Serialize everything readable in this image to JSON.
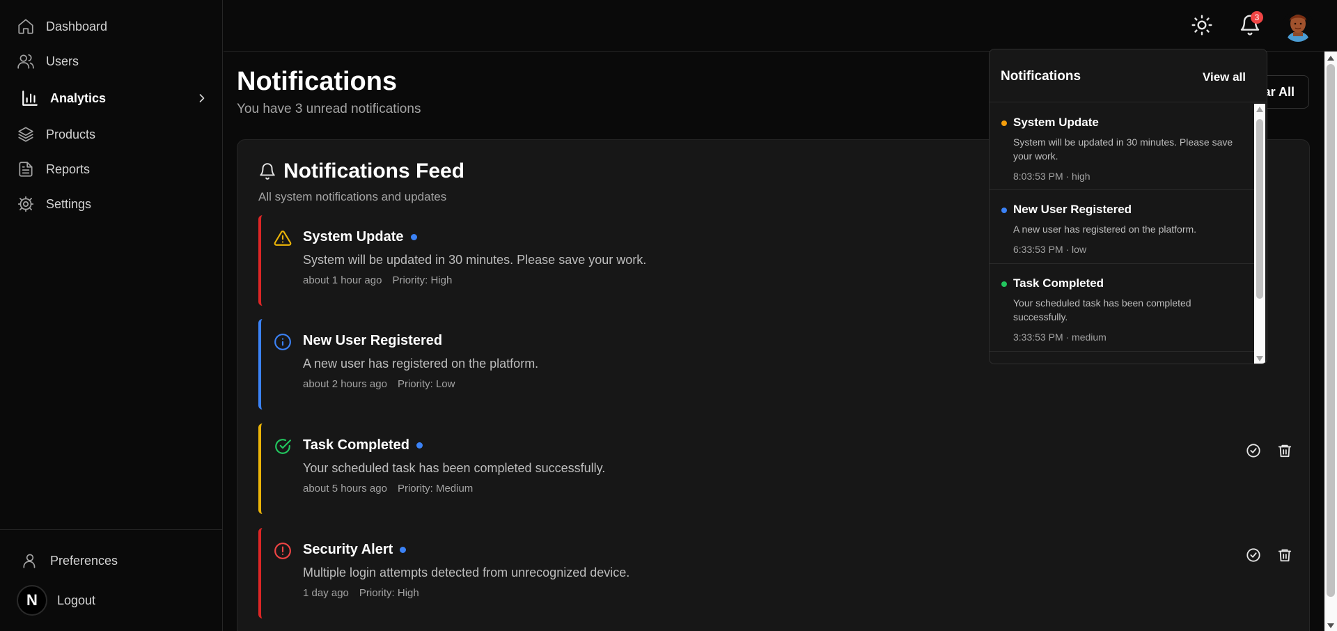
{
  "sidebar": {
    "items": [
      {
        "label": "Dashboard",
        "icon": "home-icon"
      },
      {
        "label": "Users",
        "icon": "users-icon"
      },
      {
        "label": "Analytics",
        "icon": "bar-chart-icon",
        "active": true
      },
      {
        "label": "Products",
        "icon": "layers-icon"
      },
      {
        "label": "Reports",
        "icon": "file-text-icon"
      },
      {
        "label": "Settings",
        "icon": "gear-icon"
      }
    ],
    "preferences_label": "Preferences",
    "logout_label": "Logout",
    "logout_avatar_letter": "N"
  },
  "topbar": {
    "notification_count": "3"
  },
  "page": {
    "title": "Notifications",
    "subtitle": "You have 3 unread notifications",
    "clear_all_label": "ar All"
  },
  "feed": {
    "title": "Notifications Feed",
    "subtitle": "All system notifications and updates",
    "items": [
      {
        "title": "System Update",
        "message": "System will be updated in 30 minutes. Please save your work.",
        "time": "about 1 hour ago",
        "priority": "Priority: High",
        "unread": true,
        "border_color": "#dc2626",
        "icon": "warning-triangle-icon",
        "icon_color": "#eab308"
      },
      {
        "title": "New User Registered",
        "message": "A new user has registered on the platform.",
        "time": "about 2 hours ago",
        "priority": "Priority: Low",
        "unread": false,
        "border_color": "#3b82f6",
        "icon": "info-circle-icon",
        "icon_color": "#3b82f6"
      },
      {
        "title": "Task Completed",
        "message": "Your scheduled task has been completed successfully.",
        "time": "about 5 hours ago",
        "priority": "Priority: Medium",
        "unread": true,
        "border_color": "#eab308",
        "icon": "check-circle-icon",
        "icon_color": "#22c55e"
      },
      {
        "title": "Security Alert",
        "message": "Multiple login attempts detected from unrecognized device.",
        "time": "1 day ago",
        "priority": "Priority: High",
        "unread": true,
        "border_color": "#dc2626",
        "icon": "alert-circle-icon",
        "icon_color": "#ef4444"
      }
    ]
  },
  "dropdown": {
    "title": "Notifications",
    "view_all_label": "View all",
    "items": [
      {
        "title": "System Update",
        "message": "System will be updated in 30 minutes. Please save your work.",
        "meta": "8:03:53 PM · high",
        "dot_color": "#f59e0b"
      },
      {
        "title": "New User Registered",
        "message": "A new user has registered on the platform.",
        "meta": "6:33:53 PM · low",
        "dot_color": "#3b82f6"
      },
      {
        "title": "Task Completed",
        "message": "Your scheduled task has been completed successfully.",
        "meta": "3:33:53 PM · medium",
        "dot_color": "#22c55e"
      }
    ]
  }
}
